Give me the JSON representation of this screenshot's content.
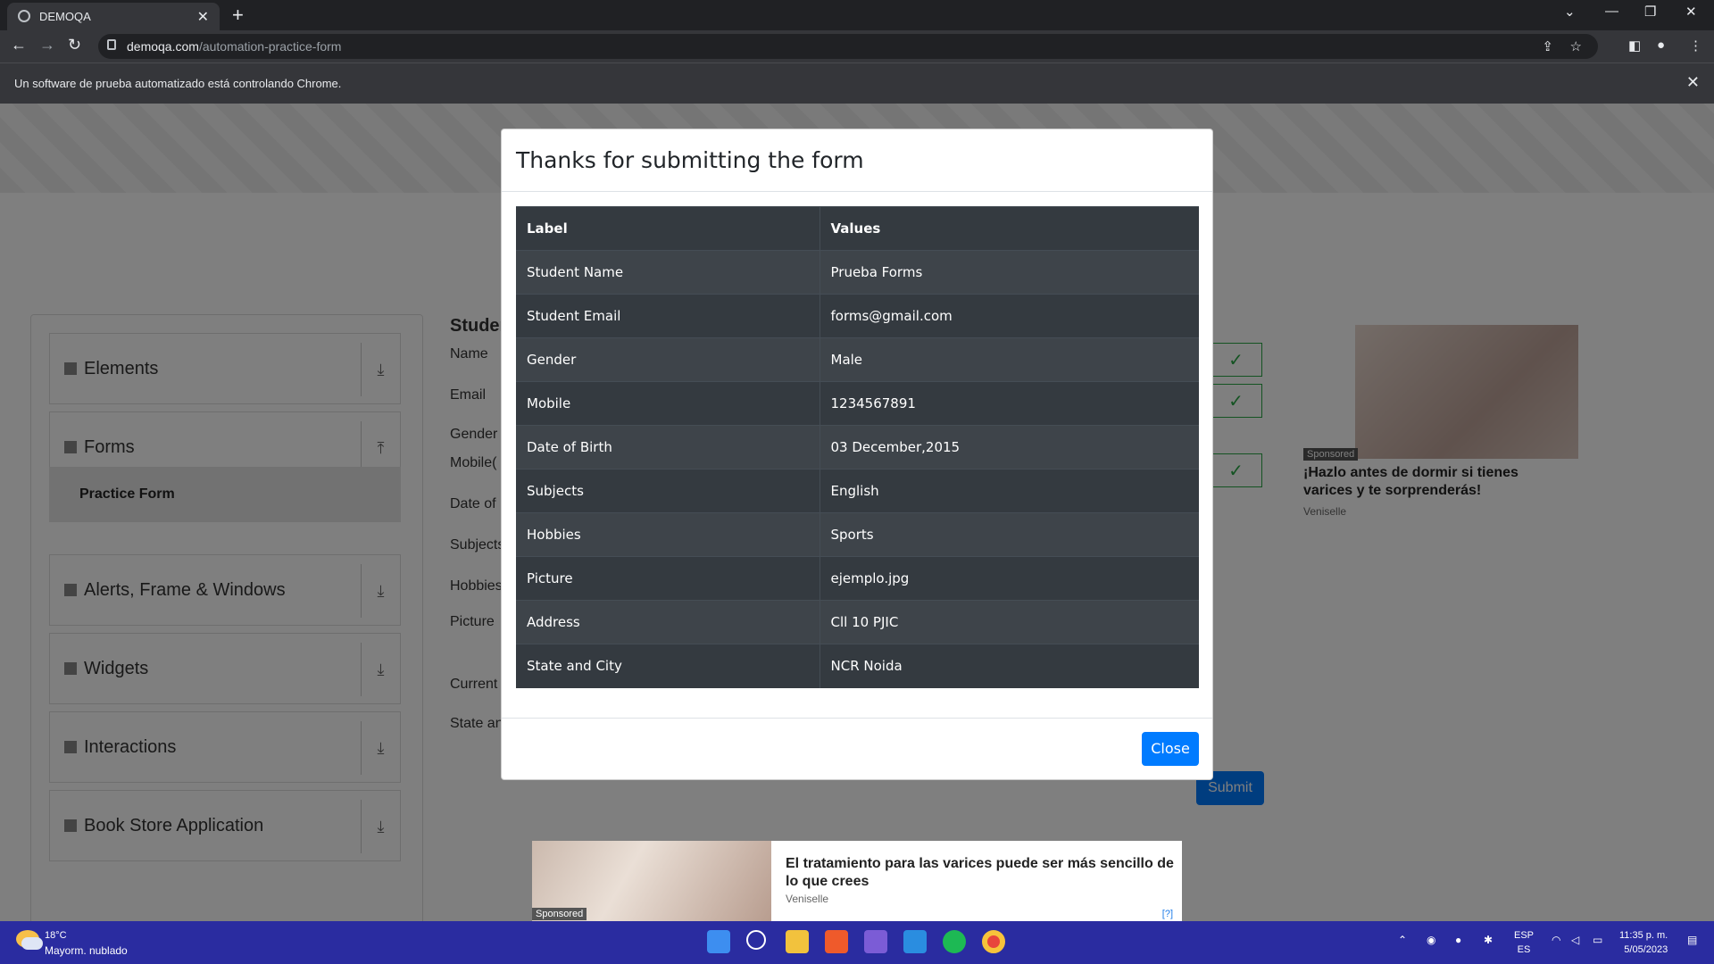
{
  "browser": {
    "tab_title": "DEMOQA",
    "url_host": "demoqa.com",
    "url_path": "/automation-practice-form",
    "infobar_message": "Un software de prueba automatizado está controlando Chrome."
  },
  "page": {
    "sidebar": {
      "groups": [
        "Elements",
        "Forms",
        "Alerts, Frame & Windows",
        "Widgets",
        "Interactions",
        "Book Store Application"
      ],
      "active_item": "Practice Form"
    },
    "form_title_partial": "Studen",
    "form_labels": [
      "Name",
      "Email",
      "Gender",
      "Mobile(",
      "Date of",
      "Subjects",
      "Hobbies",
      "Picture",
      "Current",
      "State an"
    ],
    "submit_label": "Submit",
    "ad_side": {
      "sponsored": "Sponsored",
      "headline": "¡Hazlo antes de dormir si tienes varices y te sorprenderás!",
      "source": "Veniselle"
    },
    "ad_bottom": {
      "sponsored": "Sponsored",
      "headline": "El tratamiento para las varices puede ser más sencillo de lo que crees",
      "source": "Veniselle",
      "adchoice": "[?]"
    }
  },
  "modal": {
    "title": "Thanks for submitting the form",
    "columns": [
      "Label",
      "Values"
    ],
    "rows": [
      [
        "Student Name",
        "Prueba Forms"
      ],
      [
        "Student Email",
        "forms@gmail.com"
      ],
      [
        "Gender",
        "Male"
      ],
      [
        "Mobile",
        "1234567891"
      ],
      [
        "Date of Birth",
        "03 December,2015"
      ],
      [
        "Subjects",
        "English"
      ],
      [
        "Hobbies",
        "Sports"
      ],
      [
        "Picture",
        "ejemplo.jpg"
      ],
      [
        "Address",
        "Cll 10 PJIC"
      ],
      [
        "State and City",
        "NCR Noida"
      ]
    ],
    "close_label": "Close"
  },
  "taskbar": {
    "temperature": "18°C",
    "condition": "Mayorm. nublado",
    "lang_top": "ESP",
    "lang_bottom": "ES",
    "time": "11:35 p. m.",
    "date": "5/05/2023"
  },
  "colors": {
    "primary": "#007bff",
    "table_dark": "#343a40",
    "taskbar": "#2a2ca0"
  }
}
